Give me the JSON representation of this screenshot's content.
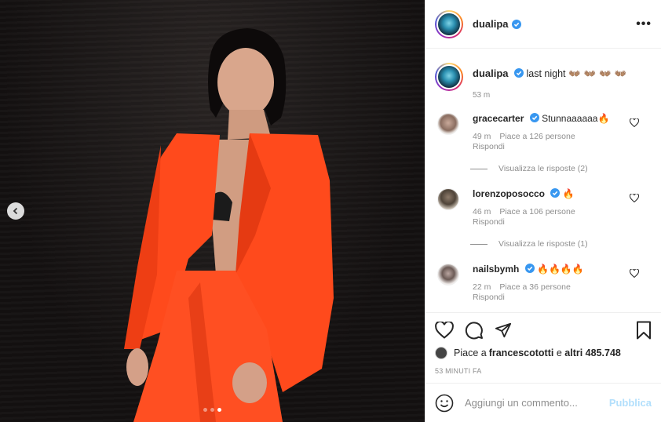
{
  "post": {
    "image_dots": 3,
    "active_dot": 2
  },
  "header": {
    "username": "dualipa",
    "more_label": "•••"
  },
  "caption": {
    "username": "dualipa",
    "text": "last night",
    "emoji": "👐🏽 👐🏽 👐🏽 👐🏽",
    "time": "53 m"
  },
  "comments": [
    {
      "username": "gracecarter",
      "text": "Stunnaaaaaa",
      "emoji": "🔥",
      "time": "49 m",
      "likes": "Piace a 126 persone",
      "reply": "Rispondi",
      "view_replies": "Visualizza le risposte (2)"
    },
    {
      "username": "lorenzoposocco",
      "text": "",
      "emoji": "🔥",
      "time": "46 m",
      "likes": "Piace a 106 persone",
      "reply": "Rispondi",
      "view_replies": "Visualizza le risposte (1)"
    },
    {
      "username": "nailsbymh",
      "text": "",
      "emoji": "🔥🔥🔥🔥",
      "time": "22 m",
      "likes": "Piace a 36 persone",
      "reply": "Rispondi"
    }
  ],
  "likes_line": {
    "prefix": "Piace a ",
    "user": "francescotottie",
    "user_display": "francescototti",
    "middle": " e ",
    "others": "altri 485.748"
  },
  "posted": "53 MINUTI FA",
  "add_comment": {
    "placeholder": "Aggiungi un commento...",
    "publish_label": "Pubblica"
  },
  "colors": {
    "verified": "#3897f0",
    "publish": "#b2dffc",
    "suit": "#ff4a1c"
  }
}
